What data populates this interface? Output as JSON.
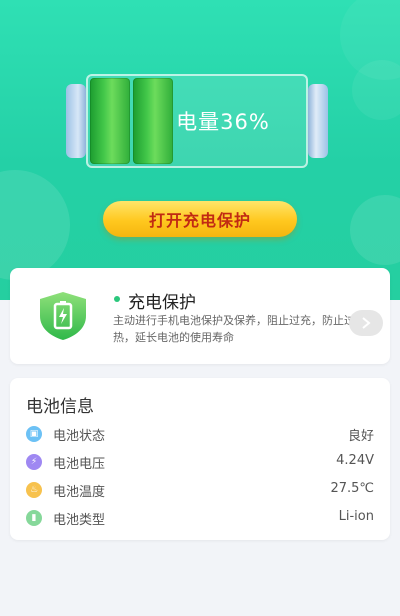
{
  "battery": {
    "label": "电量36%",
    "level_percent": 36,
    "filled_cells": 2
  },
  "hero": {
    "button_label": "打开充电保护"
  },
  "protection": {
    "title": "充电保护",
    "description": "主动进行手机电池保护及保养，阻止过充，防止过热，延长电池的使用寿命",
    "icon": "shield-battery-icon",
    "arrow_icon": "chevron-right-icon"
  },
  "info": {
    "title": "电池信息",
    "rows": [
      {
        "label": "电池状态",
        "value": "良好",
        "icon": "status-icon",
        "color": "#6cc1f5"
      },
      {
        "label": "电池电压",
        "value": "4.24V",
        "icon": "lightning-icon",
        "color": "#9f88f2"
      },
      {
        "label": "电池温度",
        "value": "27.5℃",
        "icon": "flame-icon",
        "color": "#f7c24e"
      },
      {
        "label": "电池类型",
        "value": "Li-ion",
        "icon": "battery-icon",
        "color": "#86d89a"
      }
    ]
  },
  "colors": {
    "hero_green": "#27d5a8",
    "button_yellow": "#ffc81f",
    "button_text": "#c12a13",
    "battery_green": "#43c84a"
  }
}
